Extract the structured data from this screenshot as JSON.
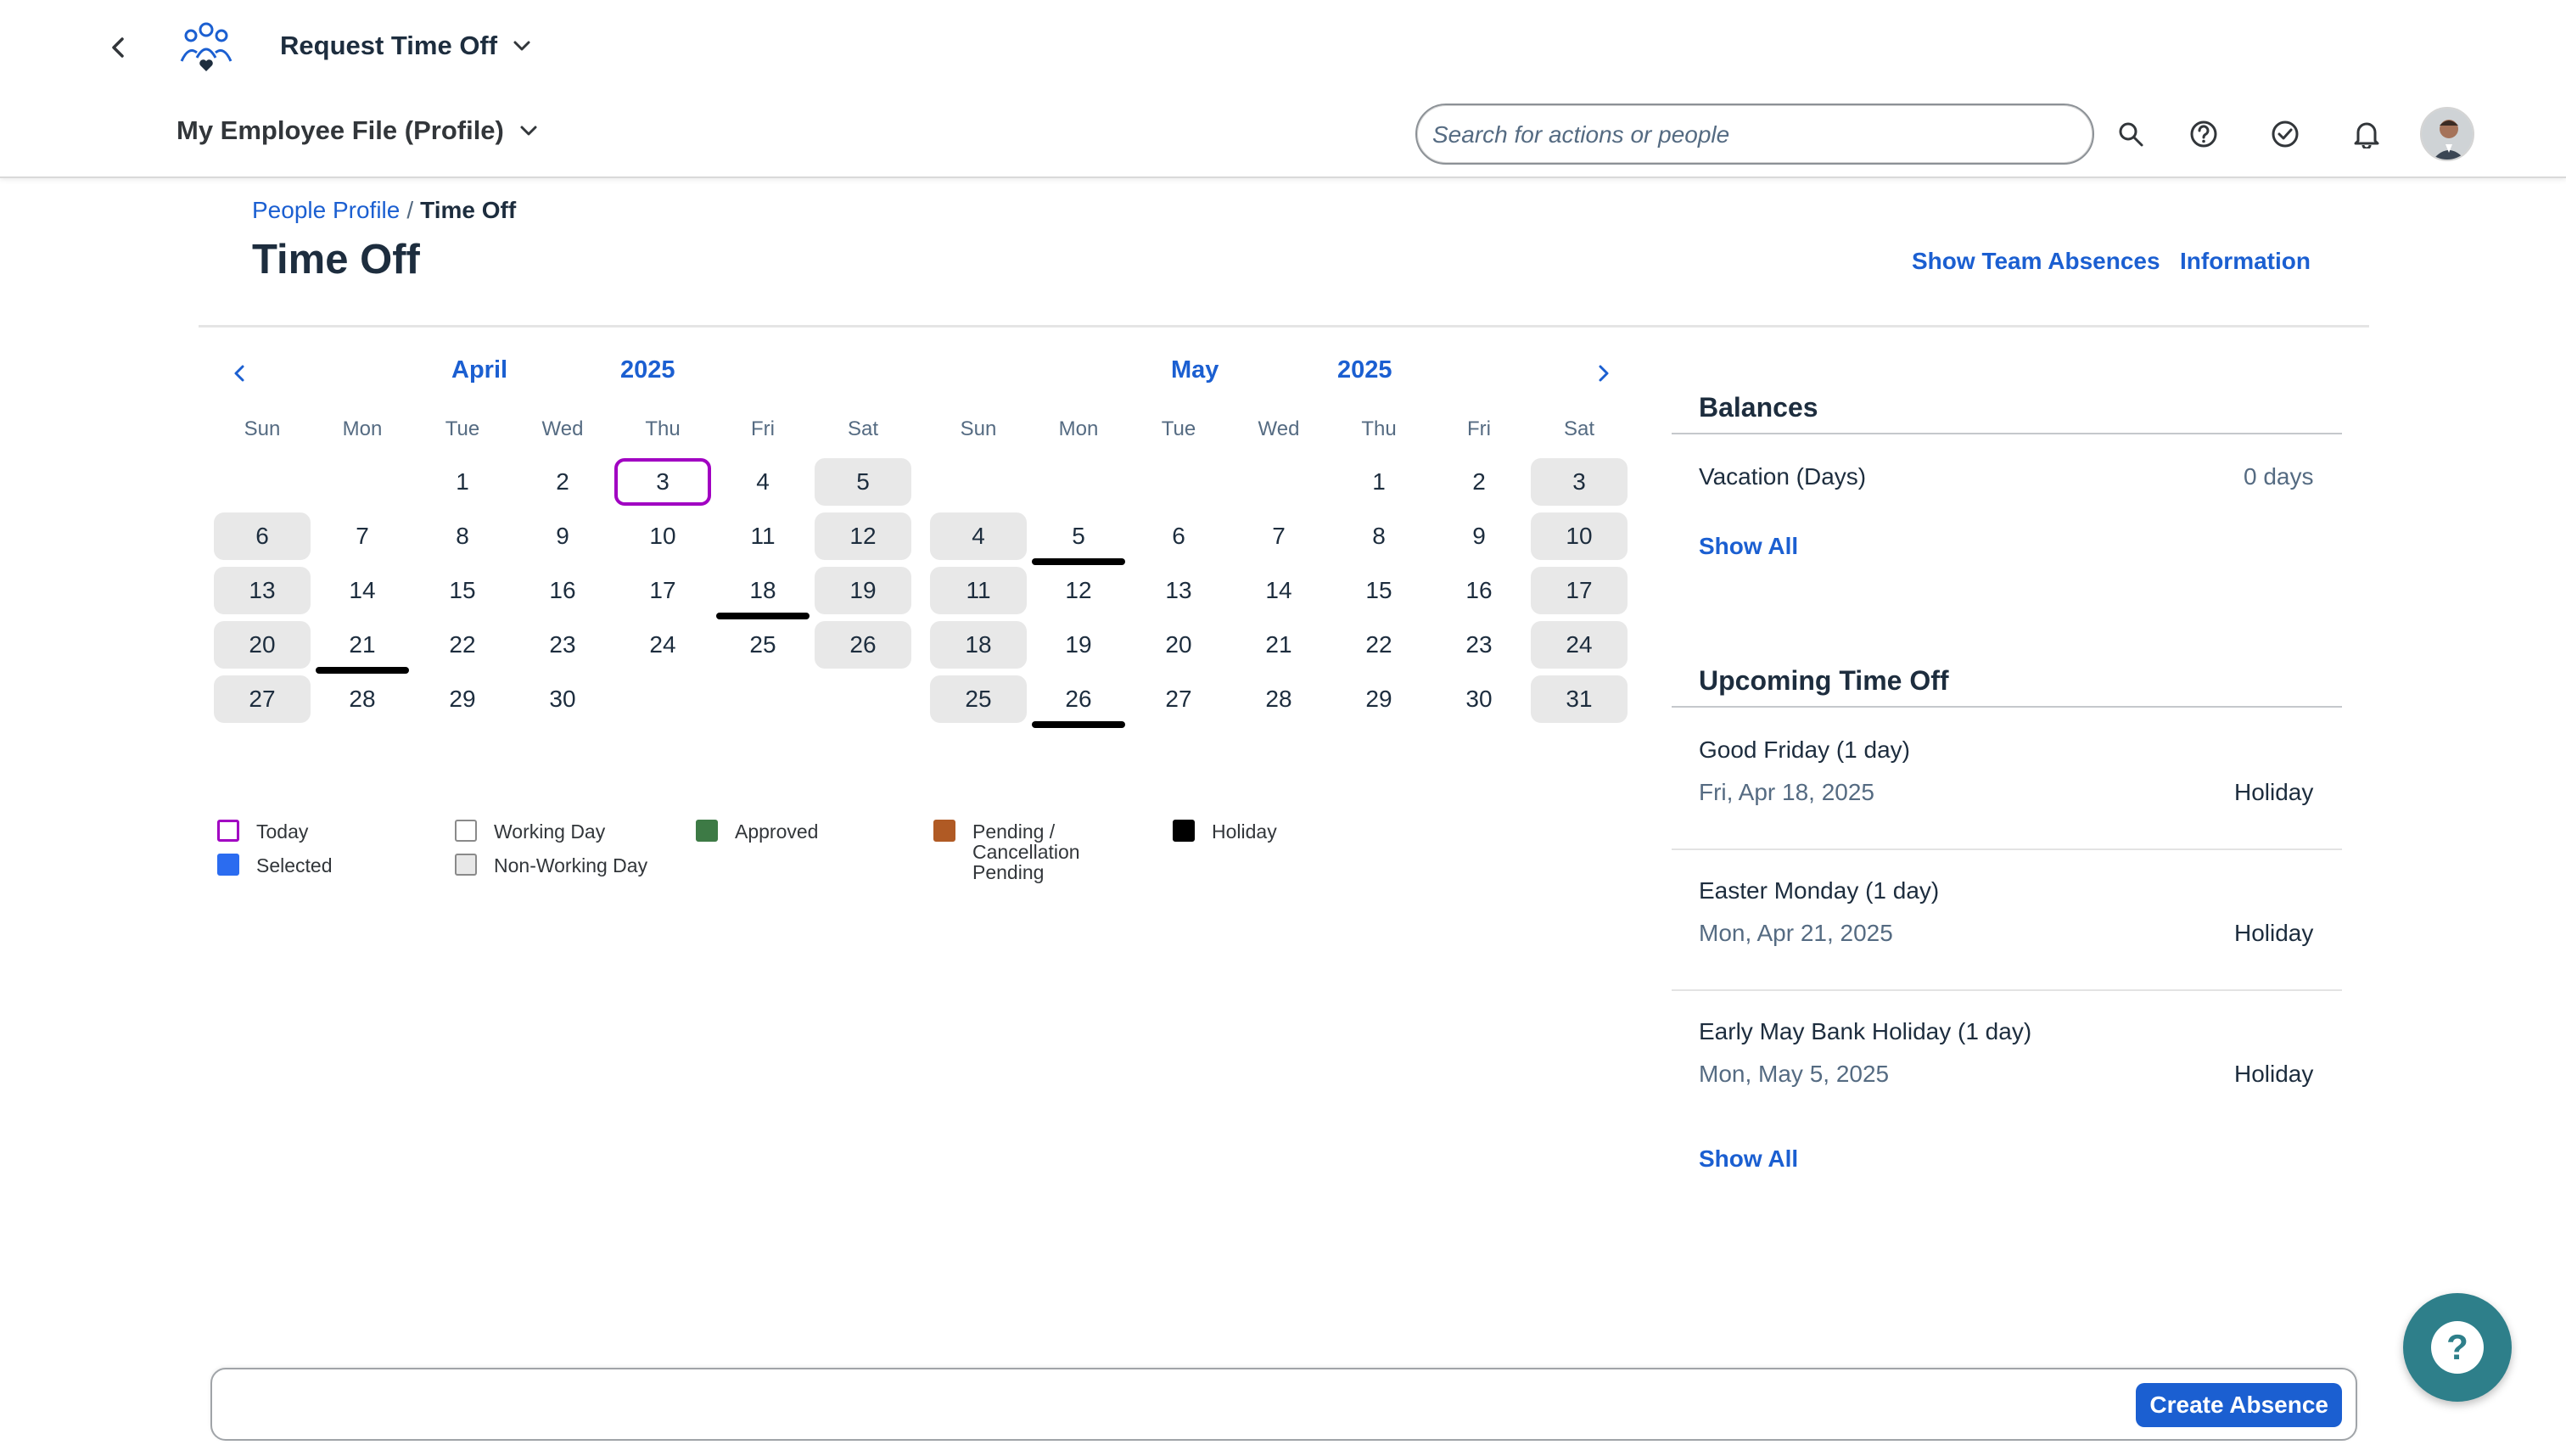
{
  "shell": {
    "app_title": "Request Time Off",
    "sub_title": "My Employee File (Profile)",
    "search_placeholder": "Search for actions or people"
  },
  "breadcrumb": {
    "parent": "People Profile",
    "separator": "/",
    "current": "Time Off"
  },
  "page_title": "Time Off",
  "header_links": {
    "team": "Show Team Absences",
    "info": "Information"
  },
  "calendar": {
    "weekdays": [
      "Sun",
      "Mon",
      "Tue",
      "Wed",
      "Thu",
      "Fri",
      "Sat"
    ],
    "months": [
      {
        "month": "April",
        "year": "2025",
        "weeks": [
          [
            "",
            "",
            "1",
            "2",
            "3",
            "4",
            "5"
          ],
          [
            "6",
            "7",
            "8",
            "9",
            "10",
            "11",
            "12"
          ],
          [
            "13",
            "14",
            "15",
            "16",
            "17",
            "18",
            "19"
          ],
          [
            "20",
            "21",
            "22",
            "23",
            "24",
            "25",
            "26"
          ],
          [
            "27",
            "28",
            "29",
            "30",
            "",
            "",
            ""
          ]
        ],
        "today": "3",
        "holidays": [
          "18",
          "21"
        ]
      },
      {
        "month": "May",
        "year": "2025",
        "weeks": [
          [
            "",
            "",
            "",
            "",
            "1",
            "2",
            "3"
          ],
          [
            "4",
            "5",
            "6",
            "7",
            "8",
            "9",
            "10"
          ],
          [
            "11",
            "12",
            "13",
            "14",
            "15",
            "16",
            "17"
          ],
          [
            "18",
            "19",
            "20",
            "21",
            "22",
            "23",
            "24"
          ],
          [
            "25",
            "26",
            "27",
            "28",
            "29",
            "30",
            "31"
          ]
        ],
        "today": "",
        "holidays": [
          "5",
          "26"
        ]
      }
    ]
  },
  "legend": {
    "today": "Today",
    "selected": "Selected",
    "working": "Working Day",
    "non_working": "Non-Working Day",
    "approved": "Approved",
    "pending": "Pending / Cancellation Pending",
    "holiday": "Holiday",
    "colors": {
      "today": "#a100c2",
      "selected": "#2b6cf0",
      "approved": "#3d7a45",
      "pending": "#b05a24",
      "holiday": "#000000"
    }
  },
  "balances": {
    "title": "Balances",
    "items": [
      {
        "label": "Vacation (Days)",
        "value": "0 days"
      }
    ],
    "show_all": "Show All"
  },
  "upcoming": {
    "title": "Upcoming Time Off",
    "items": [
      {
        "name": "Good Friday (1 day)",
        "date": "Fri, Apr 18, 2025",
        "type": "Holiday"
      },
      {
        "name": "Easter Monday (1 day)",
        "date": "Mon, Apr 21, 2025",
        "type": "Holiday"
      },
      {
        "name": "Early May Bank Holiday (1 day)",
        "date": "Mon, May 5, 2025",
        "type": "Holiday"
      }
    ],
    "show_all": "Show All"
  },
  "footer": {
    "create_label": "Create Absence"
  },
  "help_fab": {
    "label": "?"
  },
  "icons": [
    "back-icon",
    "app-people-icon",
    "chevron-down-icon",
    "search-icon",
    "help-icon",
    "task-check-icon",
    "bell-icon",
    "avatar"
  ]
}
